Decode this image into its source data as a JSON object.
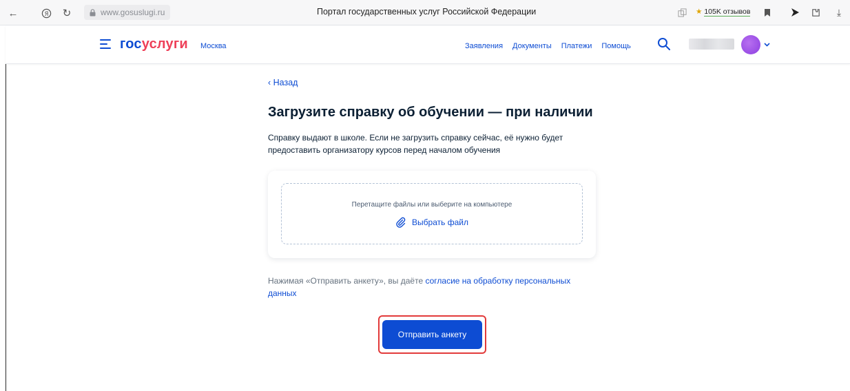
{
  "browser": {
    "url": "www.gosuslugi.ru",
    "page_title": "Портал государственных услуг Российской Федерации",
    "reviews": "105K отзывов"
  },
  "header": {
    "logo_part1": "гос",
    "logo_part2": "услуги",
    "city": "Москва",
    "nav": [
      "Заявления",
      "Документы",
      "Платежи",
      "Помощь"
    ]
  },
  "main": {
    "back_label": "Назад",
    "title": "Загрузите справку об обучении — при наличии",
    "description": "Справку выдают в школе. Если не загрузить справку сейчас, её нужно будет предоставить организатору курсов перед началом обучения",
    "upload": {
      "hint": "Перетащите файлы или выберите на компьютере",
      "choose_label": "Выбрать файл"
    },
    "consent_prefix": "Нажимая «Отправить анкету», вы даёте ",
    "consent_link": "согласие на обработку персональных данных",
    "submit_label": "Отправить анкету"
  },
  "colors": {
    "accent": "#0d4cd3",
    "brand_red": "#ee3f58",
    "highlight": "#e23a3a"
  }
}
